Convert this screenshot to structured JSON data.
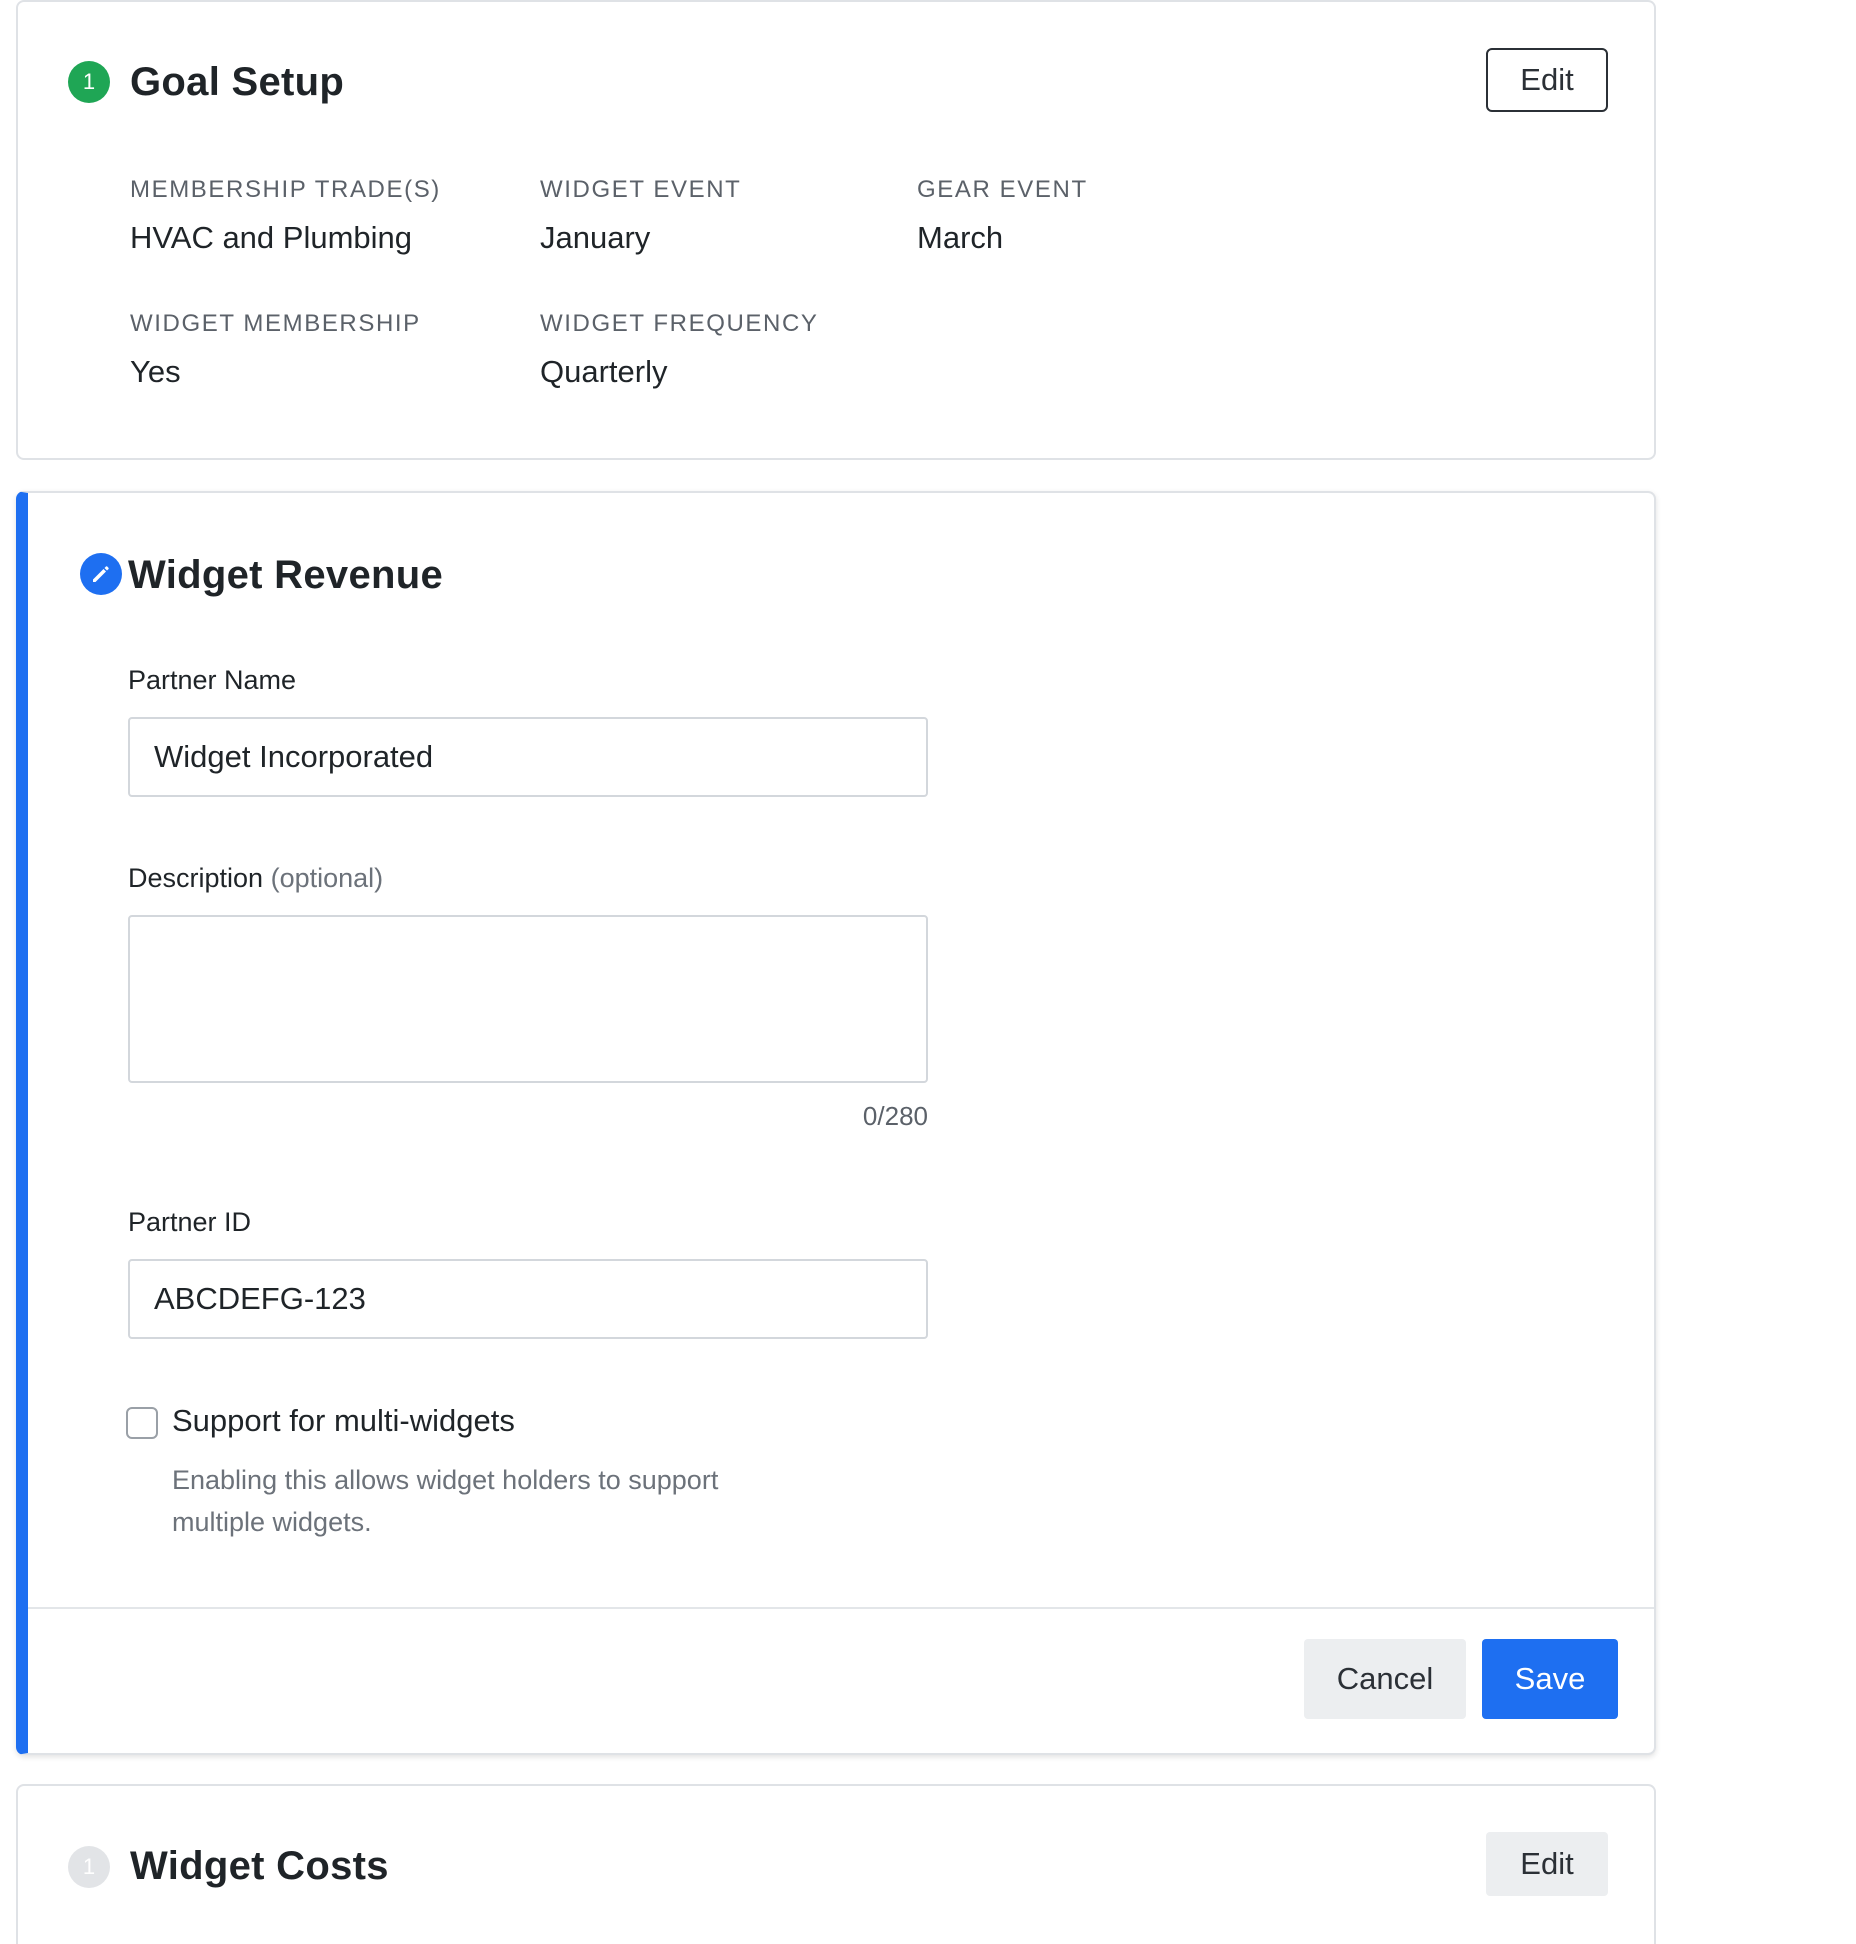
{
  "goal_setup": {
    "step_number": "1",
    "step_color": "#1fa655",
    "title": "Goal Setup",
    "edit_label": "Edit",
    "fields": {
      "membership_trades": {
        "label": "MEMBERSHIP TRADE(S)",
        "value": "HVAC and Plumbing"
      },
      "widget_event": {
        "label": "WIDGET EVENT",
        "value": "January"
      },
      "gear_event": {
        "label": "GEAR EVENT",
        "value": "March"
      },
      "widget_membership": {
        "label": "WIDGET MEMBERSHIP",
        "value": "Yes"
      },
      "widget_frequency": {
        "label": "WIDGET FREQUENCY",
        "value": "Quarterly"
      }
    }
  },
  "widget_revenue": {
    "icon": "pencil-icon",
    "accent_color": "#1e6ff1",
    "title": "Widget Revenue",
    "partner_name": {
      "label": "Partner Name",
      "value": "Widget Incorporated"
    },
    "description": {
      "label": "Description",
      "optional": "(optional)",
      "value": "",
      "char_count": "0/280"
    },
    "partner_id": {
      "label": "Partner ID",
      "value": "ABCDEFG-123"
    },
    "multi_widgets": {
      "checked": false,
      "label": "Support for multi-widgets",
      "help_line1": "Enabling this allows widget holders to support",
      "help_line2": "multiple widgets."
    },
    "cancel_label": "Cancel",
    "save_label": "Save"
  },
  "widget_costs": {
    "step_number": "1",
    "step_color": "#e2e4e7",
    "title": "Widget Costs",
    "edit_label": "Edit"
  }
}
